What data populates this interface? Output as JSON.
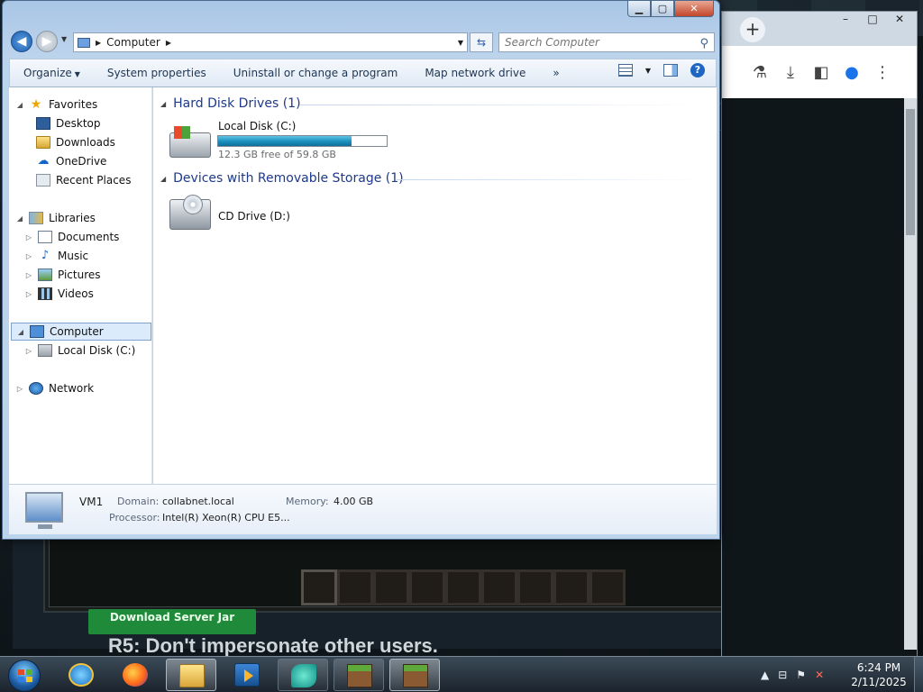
{
  "explorer": {
    "breadcrumb": "Computer",
    "search_placeholder": "Search Computer",
    "commands": {
      "organize": "Organize",
      "system_properties": "System properties",
      "uninstall": "Uninstall or change a program",
      "map_drive": "Map network drive",
      "more": "»"
    },
    "nav": {
      "favorites": "Favorites",
      "desktop": "Desktop",
      "downloads": "Downloads",
      "onedrive": "OneDrive",
      "recent_places": "Recent Places",
      "libraries": "Libraries",
      "documents": "Documents",
      "music": "Music",
      "pictures": "Pictures",
      "videos": "Videos",
      "computer": "Computer",
      "local_disk": "Local Disk (C:)",
      "network": "Network"
    },
    "groups": {
      "hdd": "Hard Disk Drives (1)",
      "removable": "Devices with Removable Storage (1)"
    },
    "drive_c": {
      "name": "Local Disk (C:)",
      "free_text": "12.3 GB free of 59.8 GB",
      "used_fraction": 0.794
    },
    "drive_d": {
      "name": "CD Drive (D:)"
    },
    "details": {
      "computer_name": "VM1",
      "domain_label": "Domain:",
      "domain_value": "collabnet.local",
      "memory_label": "Memory:",
      "memory_value": "4.00 GB",
      "processor_label": "Processor:",
      "processor_value": "Intel(R) Xeon(R) CPU E5..."
    }
  },
  "background": {
    "download_button": "Download Server Jar",
    "rule_text": "R5: Don't impersonate other users."
  },
  "taskbar": {
    "time": "6:24 PM",
    "date": "2/11/2025"
  },
  "colors": {
    "progress_fill": "#1a8fbd",
    "group_header": "#1e3a8a",
    "taskbar": "#1b242d"
  }
}
